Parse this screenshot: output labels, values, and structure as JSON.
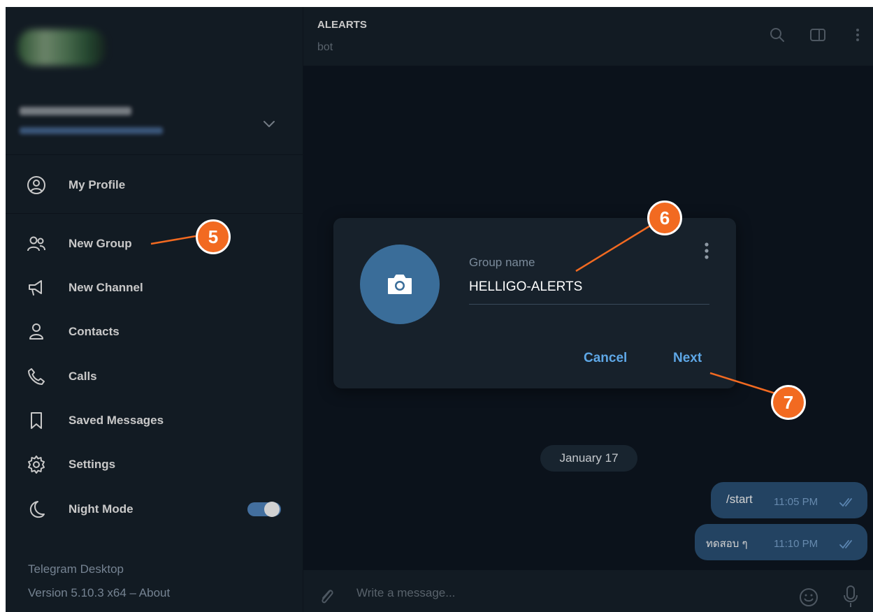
{
  "sidebar": {
    "menu": [
      {
        "label": "My Profile",
        "icon": "user-circle-icon"
      },
      {
        "label": "New Group",
        "icon": "users-icon"
      },
      {
        "label": "New Channel",
        "icon": "megaphone-icon"
      },
      {
        "label": "Contacts",
        "icon": "person-icon"
      },
      {
        "label": "Calls",
        "icon": "phone-icon"
      },
      {
        "label": "Saved Messages",
        "icon": "bookmark-icon"
      },
      {
        "label": "Settings",
        "icon": "gear-icon"
      },
      {
        "label": "Night Mode",
        "icon": "moon-icon"
      }
    ],
    "night_mode_on": true,
    "app_name": "Telegram Desktop",
    "version": "Version 5.10.3 x64 – About"
  },
  "chat": {
    "title": "ALEARTS",
    "subtitle": "bot",
    "date": "January 17",
    "messages": [
      {
        "text": "/start",
        "time": "11:05 PM"
      },
      {
        "text": "ทดสอบ ๆ",
        "time": "11:10 PM"
      }
    ],
    "compose_placeholder": "Write a message..."
  },
  "dialog": {
    "field_label": "Group name",
    "field_value": "HELLIGO-ALERTS",
    "cancel_label": "Cancel",
    "next_label": "Next"
  },
  "annotations": {
    "step_5": "5",
    "step_6": "6",
    "step_7": "7"
  },
  "colors": {
    "accent": "#5ea7e6",
    "bubble": "#2b5278",
    "badge": "#f26a21",
    "sidebar": "#17212b",
    "background": "#0e1621"
  }
}
